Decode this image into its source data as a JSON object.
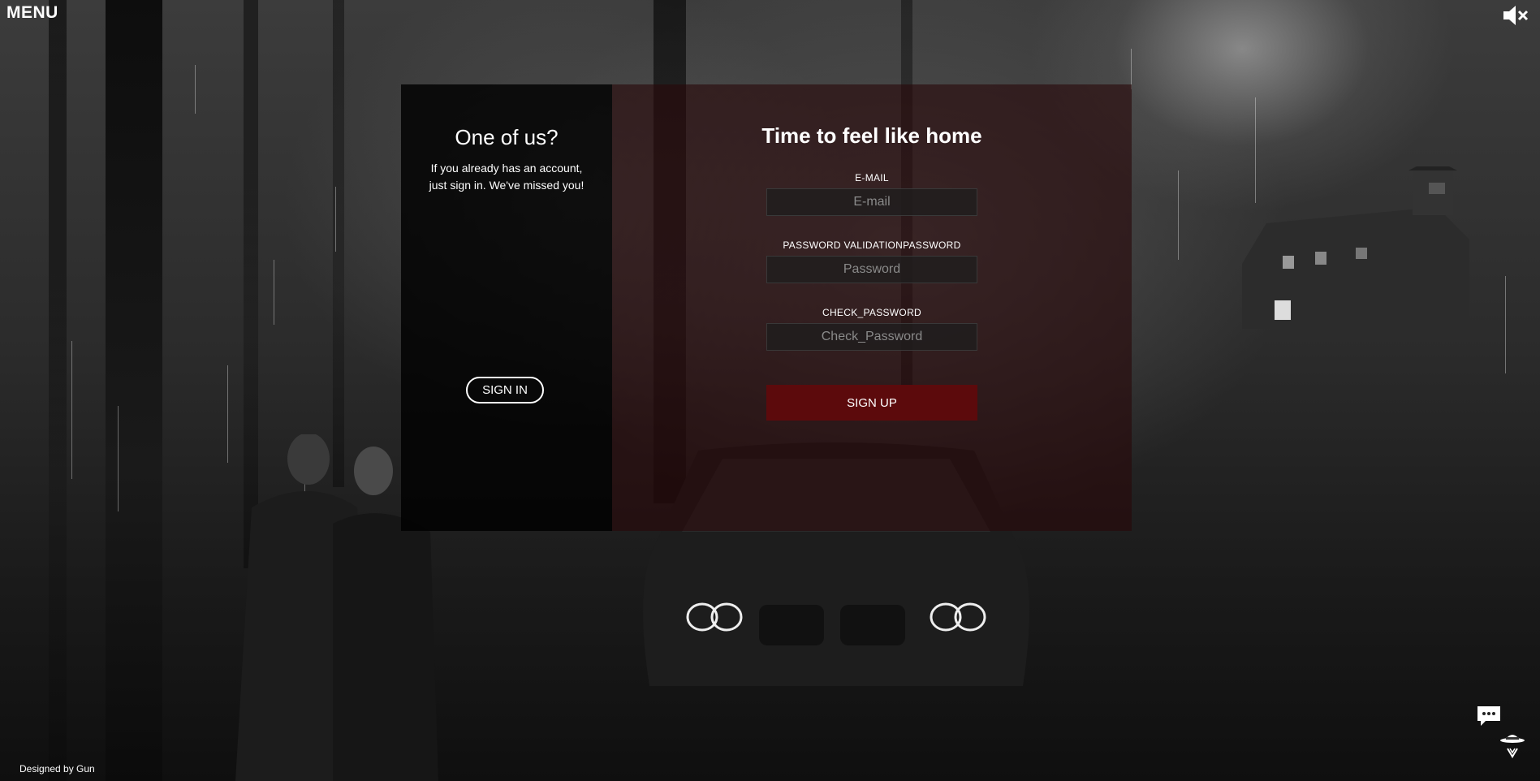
{
  "header": {
    "menu_label": "MENU",
    "mute_icon": "speaker-mute-icon"
  },
  "signin_panel": {
    "title": "One of us?",
    "description": "If you already has an account, just sign in. We've missed you!",
    "button_label": "SIGN IN"
  },
  "signup_panel": {
    "title": "Time to feel like home",
    "fields": [
      {
        "label": "E-MAIL",
        "placeholder": "E-mail",
        "value": ""
      },
      {
        "label": "PASSWORD VALIDATIONPASSWORD",
        "placeholder": "Password",
        "value": ""
      },
      {
        "label": "CHECK_PASSWORD",
        "placeholder": "Check_Password",
        "value": ""
      }
    ],
    "button_label": "SIGN UP"
  },
  "footer": {
    "credit": "Designed by Gun"
  },
  "widgets": {
    "chat_icon": "chat-bubble-icon",
    "hat_icon": "detective-hat-icon"
  },
  "colors": {
    "signup_button": "#5c0a0c",
    "right_panel_tint": "#280810",
    "left_panel_tint": "#000000"
  }
}
